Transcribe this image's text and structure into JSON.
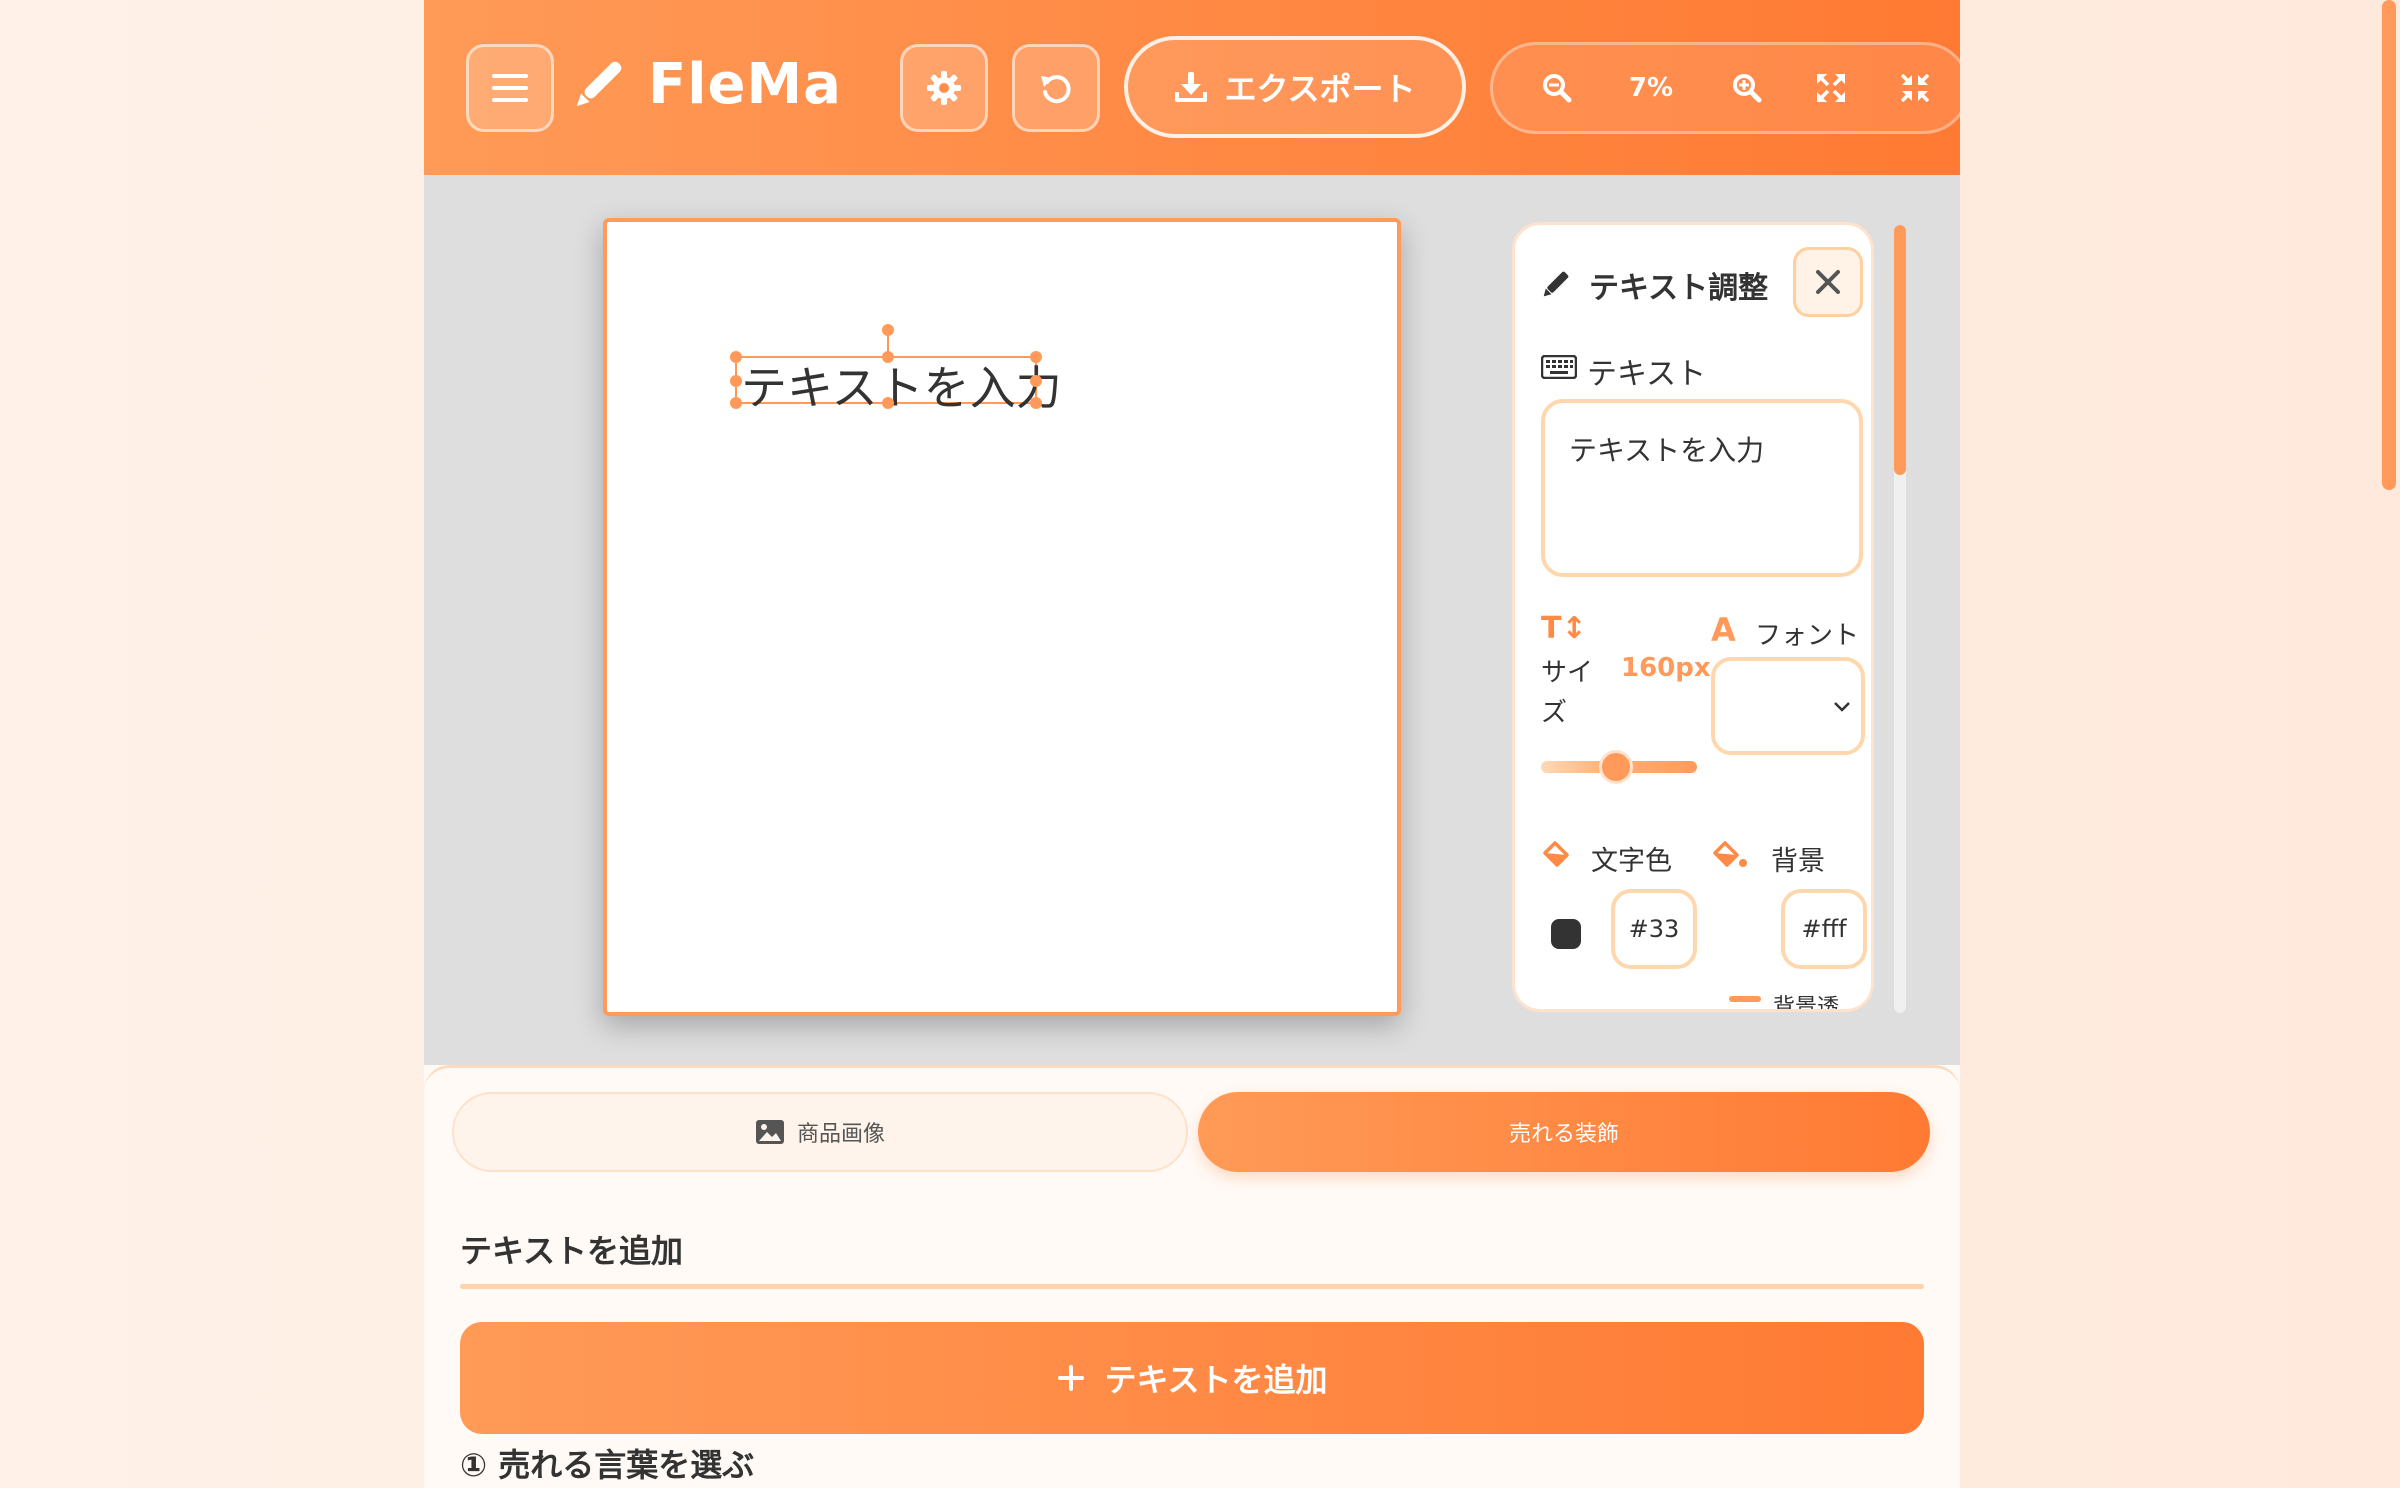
{
  "header": {
    "app_name": "FleMa",
    "export_label": "エクスポート",
    "zoom_level": "7%"
  },
  "canvas": {
    "selected_text": "テキストを入力"
  },
  "panel": {
    "title": "テキスト調整",
    "text_label": "テキスト",
    "text_value": "テキストを入力",
    "size_label": "サイズ",
    "size_value": "160px",
    "font_label": "フォント",
    "font_value": "",
    "text_color_label": "文字色",
    "text_color_value": "#33",
    "bg_label": "背景",
    "bg_value": "#fff",
    "bg_opacity_label": "背景透",
    "text_color_swatch": "#333333"
  },
  "tabs": [
    {
      "label": "商品画像",
      "active": false
    },
    {
      "label": "売れる装飾",
      "active": true
    }
  ],
  "section": {
    "title": "テキストを追加",
    "add_button": "テキストを追加",
    "step_title": "① 売れる言葉を選ぶ"
  },
  "colors": {
    "accent": "#ff8a45",
    "accent_light": "#ffd7ad",
    "canvas_bg": "#dedede"
  }
}
